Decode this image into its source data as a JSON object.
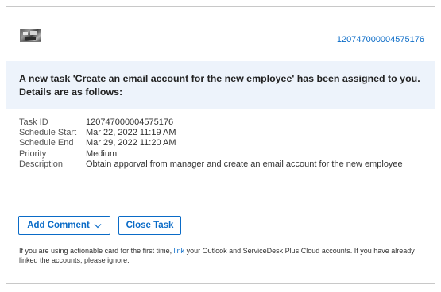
{
  "header": {
    "task_number": "120747000004575176"
  },
  "banner": {
    "message": "A new task 'Create an email account for the new employee' has been assigned to you. Details are as follows:"
  },
  "details": [
    {
      "label": "Task ID",
      "value": "120747000004575176"
    },
    {
      "label": "Schedule Start",
      "value": "Mar 22, 2022 11:19 AM"
    },
    {
      "label": "Schedule End",
      "value": "Mar 29, 2022 11:20 AM"
    },
    {
      "label": "Priority",
      "value": "Medium"
    },
    {
      "label": "Description",
      "value": "Obtain apporval from manager and create an email account for the new employee"
    }
  ],
  "actions": {
    "add_comment_label": "Add Comment",
    "close_task_label": "Close Task"
  },
  "footer": {
    "text_before": "If you are using actionable card for the first time, ",
    "link_text": "link",
    "text_after": " your Outlook and ServiceDesk Plus Cloud accounts. If you have already linked the accounts, please ignore."
  },
  "colors": {
    "accent": "#0a6bc7",
    "banner_bg": "#edf3fb"
  },
  "icons": {
    "logo": "company-logo-image",
    "dropdown": "chevron-down-icon"
  }
}
